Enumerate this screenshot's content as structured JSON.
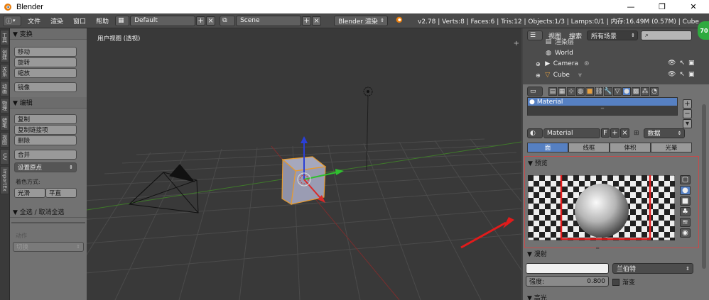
{
  "window": {
    "title": "Blender"
  },
  "menu": {
    "file": "文件",
    "render": "渲染",
    "window": "窗口",
    "help": "帮助"
  },
  "header": {
    "layout_value": "Default",
    "scene_value": "Scene",
    "engine_value": "Blender 渲染",
    "stats": "v2.78 | Verts:8 | Faces:6 | Tris:12 | Objects:1/3 | Lamps:0/1 | 内存:16.49M (0.57M) | Cube"
  },
  "side_tabs": [
    "工具",
    "创建",
    "关系",
    "动画",
    "物理",
    "蜡笔",
    "视图",
    "UV",
    "ImportEx"
  ],
  "toolshelf": {
    "transform_header": "▼ 变换",
    "move": "移动",
    "rotate": "旋转",
    "scale": "缩放",
    "mirror": "镜像",
    "edit_header": "▼ 编辑",
    "duplicate": "复制",
    "duplicate_linked": "复制链接项",
    "delete": "删除",
    "join": "合并",
    "set_origin": "设置原点",
    "shading_label": "着色方式:",
    "smooth": "光滑",
    "flat": "平直",
    "select_header": "▼ 全选 / 取消全选",
    "action_label": "动作",
    "action_value": "切换"
  },
  "viewport": {
    "label": "用户视图 (透视)"
  },
  "outliner": {
    "view": "视图",
    "search": "搜索",
    "filter": "所有场景",
    "items": [
      "渲染层",
      "World",
      "Camera",
      "Cube"
    ]
  },
  "properties": {
    "slot_name": "Material",
    "material_name": "Material",
    "fake_user": "F",
    "link_value": "数据",
    "tabs": [
      "面",
      "线框",
      "体积",
      "光晕"
    ],
    "preview_header": "▼ 预览",
    "diffuse_header": "▼ 漫射",
    "shader_value": "兰伯特",
    "intensity_label": "强度:",
    "intensity_value": "0.800",
    "ramp_label": "渐变",
    "specular_header": "▼ 高光"
  },
  "colors": {
    "highlight_red": "#e11b1b",
    "selection_blue": "#5680c2",
    "badge_green": "#2faa3f"
  },
  "badge": "70"
}
